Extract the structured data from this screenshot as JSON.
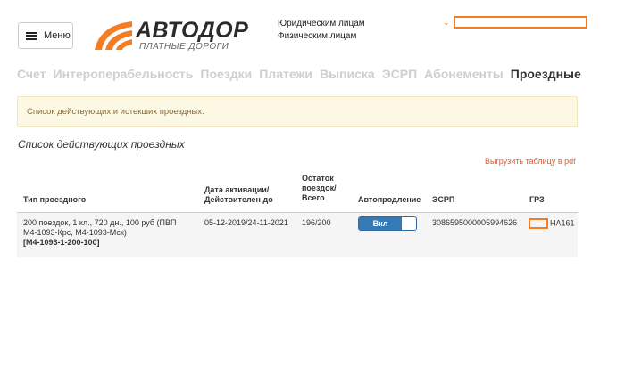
{
  "header": {
    "menu_label": "Меню",
    "logo_title": "АВТОДОР",
    "logo_subtitle": "ПЛАТНЫЕ ДОРОГИ",
    "audience": [
      "Юридическим лицам",
      "Физическим лицам"
    ],
    "accent_color": "#f57c20"
  },
  "tabs": [
    {
      "label": "Счет",
      "active": false
    },
    {
      "label": "Интероперабельность",
      "active": false
    },
    {
      "label": "Поездки",
      "active": false
    },
    {
      "label": "Платежи",
      "active": false
    },
    {
      "label": "Выписка",
      "active": false
    },
    {
      "label": "ЭСРП",
      "active": false
    },
    {
      "label": "Абонементы",
      "active": false
    },
    {
      "label": "Проездные",
      "active": true
    }
  ],
  "notice": "Список действующих и истекших проездных.",
  "section_title": "Список действующих проездных",
  "export_pdf_label": "Выгрузить таблицу в pdf",
  "table": {
    "headers": {
      "type": "Тип проездного",
      "dates": [
        "Дата активации/",
        "Действителен до"
      ],
      "remaining": [
        "Остаток",
        "поездок/",
        "Всего"
      ],
      "autorenew": "Автопродление",
      "esrp": "ЭСРП",
      "grz": "ГРЗ"
    },
    "rows": [
      {
        "type_line1": "200 поездок, 1 кл., 720 дн., 100 руб (ПВП",
        "type_line2": "М4-1093-Крс, М4-1093-Мск)",
        "code": "[M4-1093-1-200-100]",
        "dates": "05-12-2019/24-11-2021",
        "remaining": "196/200",
        "autorenew_label": "Вкл",
        "esrp": "3086595000005994626",
        "grz_suffix": "НА161"
      }
    ]
  }
}
